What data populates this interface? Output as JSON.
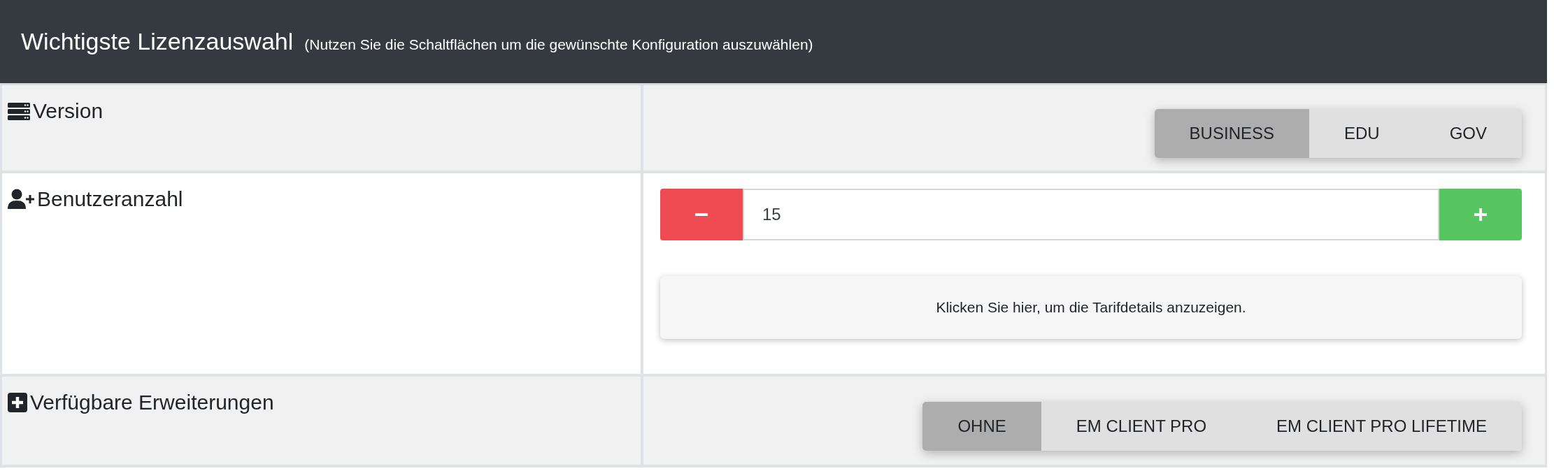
{
  "header": {
    "title": "Wichtigste Lizenzauswahl",
    "subtitle": "(Nutzen Sie die Schaltflächen um die gewünschte Konfiguration auszuwählen)"
  },
  "rows": [
    {
      "label": "Version",
      "kind": "options",
      "options": [
        {
          "label": "BUSINESS",
          "selected": true
        },
        {
          "label": "EDU",
          "selected": false
        },
        {
          "label": "GOV",
          "selected": false
        }
      ]
    },
    {
      "label": "Benutzeranzahl",
      "kind": "stepper",
      "value": "15",
      "details": "Klicken Sie hier, um die Tarifdetails anzuzeigen."
    },
    {
      "label": "Verfügbare Erweiterungen",
      "kind": "options",
      "options": [
        {
          "label": "OHNE",
          "selected": true
        },
        {
          "label": "EM CLIENT PRO",
          "selected": false
        },
        {
          "label": "EM CLIENT PRO LIFETIME",
          "selected": false
        }
      ]
    }
  ]
}
